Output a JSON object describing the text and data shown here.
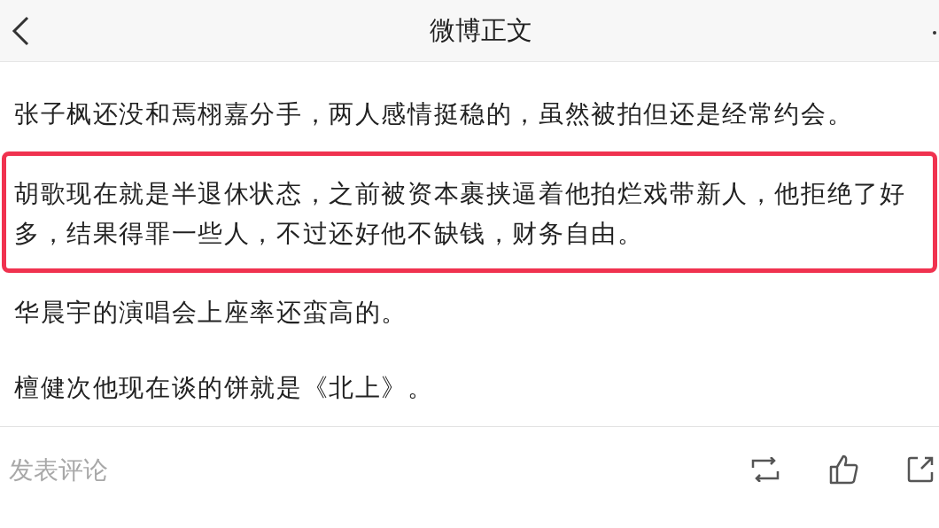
{
  "header": {
    "title": "微博正文"
  },
  "paragraphs": [
    {
      "text": "张子枫还没和焉栩嘉分手，两人感情挺稳的，虽然被拍但还是经常约会。",
      "highlighted": false
    },
    {
      "text": "胡歌现在就是半退休状态，之前被资本裹挟逼着他拍烂戏带新人，他拒绝了好多，结果得罪一些人，不过还好他不缺钱，财务自由。",
      "highlighted": true
    },
    {
      "text": "华晨宇的演唱会上座率还蛮高的。",
      "highlighted": false
    },
    {
      "text": "檀健次他现在谈的饼就是《北上》。",
      "highlighted": false
    }
  ],
  "comment_bar": {
    "placeholder": "发表评论"
  }
}
